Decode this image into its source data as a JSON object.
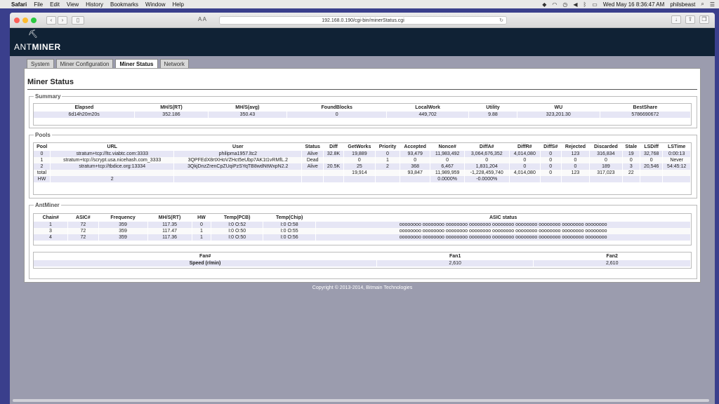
{
  "menubar": {
    "apple": "",
    "app": "Safari",
    "items": [
      "File",
      "Edit",
      "View",
      "History",
      "Bookmarks",
      "Window",
      "Help"
    ],
    "clock": "Wed May 16  8:36:47 AM",
    "user": "philsbeast"
  },
  "browser": {
    "url": "192.168.0.190/cgi-bin/minerStatus.cgi",
    "reader": "A  A"
  },
  "header": {
    "logo_prefix": "ANT",
    "logo_suffix": "MINER"
  },
  "tabs": [
    {
      "label": "System"
    },
    {
      "label": "Miner Configuration"
    },
    {
      "label": "Miner Status"
    },
    {
      "label": "Network"
    }
  ],
  "page_title": "Miner Status",
  "summary": {
    "legend": "Summary",
    "headers": [
      "Elapsed",
      "MH/S(RT)",
      "MH/S(avg)",
      "FoundBlocks",
      "LocalWork",
      "Utility",
      "WU",
      "BestShare"
    ],
    "row": [
      "6d14h20m20s",
      "352.186",
      "350.43",
      "0",
      "449,702",
      "9.88",
      "323,201.30",
      "5786690672"
    ]
  },
  "pools": {
    "legend": "Pools",
    "headers": [
      "Pool",
      "URL",
      "User",
      "Status",
      "Diff",
      "GetWorks",
      "Priority",
      "Accepted",
      "Nonce#",
      "DiffA#",
      "DiffR#",
      "DiffS#",
      "Rejected",
      "Discarded",
      "Stale",
      "LSDiff",
      "LSTime"
    ],
    "rows": [
      [
        "0",
        "stratum+tcp://ltc.viabtc.com:3333",
        "philipma1957.ltc2",
        "Alive",
        "32.8K",
        "19,889",
        "0",
        "93,479",
        "11,983,492",
        "3,064,676,352",
        "4,014,080",
        "0",
        "123",
        "316,834",
        "19",
        "32,768",
        "0:00:13"
      ],
      [
        "1",
        "stratum+tcp://scrypt.usa.nicehash.com_3333",
        "3QPFEdX8rtXHoVZHct5eUbp7AK1t1vRMfL.2",
        "Dead",
        "",
        "0",
        "1",
        "0",
        "0",
        "0",
        "0",
        "0",
        "0",
        "0",
        "0",
        "0",
        "Never"
      ],
      [
        "2",
        "stratum+tcp://tbdice.org:13334",
        "3QkjDnzZrenCpZUqiPzSYqTB8wdNtWxpN2.2",
        "Alive",
        "20.5K",
        "25",
        "2",
        "368",
        "6,467",
        "1,831,204",
        "0",
        "0",
        "0",
        "189",
        "3",
        "20,546",
        "54:45:12"
      ],
      [
        "total",
        "",
        "",
        "",
        "",
        "19,914",
        "",
        "93,847",
        "11,989,959",
        "-1,228,459,740",
        "4,014,080",
        "0",
        "123",
        "317,023",
        "22",
        "",
        ""
      ],
      [
        "HW",
        "2",
        "",
        "",
        "",
        "",
        "",
        "",
        "0.0000%",
        "-0.0000%",
        "",
        "",
        "",
        "",
        "",
        "",
        ""
      ]
    ]
  },
  "antminer": {
    "legend": "AntMiner",
    "headers": [
      "Chain#",
      "ASIC#",
      "Frequency",
      "MH/S(RT)",
      "HW",
      "Temp(PCB)",
      "Temp(Chip)",
      "ASIC status"
    ],
    "rows": [
      [
        "1",
        "72",
        "359",
        "117.35",
        "0",
        "I:0 O:52",
        "I:0 O:58",
        "oooooooo oooooooo oooooooo oooooooo oooooooo oooooooo oooooooo oooooooo oooooooo"
      ],
      [
        "3",
        "72",
        "359",
        "117.47",
        "1",
        "I:0 O:50",
        "I:0 O:55",
        "oooooooo oooooooo oooooooo oooooooo oooooooo oooooooo oooooooo oooooooo oooooooo"
      ],
      [
        "4",
        "72",
        "359",
        "117.36",
        "1",
        "I:0 O:50",
        "I:0 O:56",
        "oooooooo oooooooo oooooooo oooooooo oooooooo oooooooo oooooooo oooooooo oooooooo"
      ]
    ],
    "fan_headers": [
      "Fan#",
      "Fan1",
      "Fan2"
    ],
    "fan_row": [
      "Speed (r/min)",
      "2,610",
      "2,610"
    ]
  },
  "footer": "Copyright © 2013-2014, Bitmain Technologies"
}
